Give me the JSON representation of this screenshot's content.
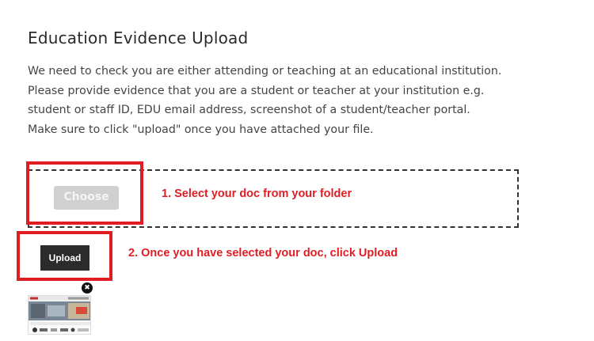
{
  "page": {
    "title": "Education Evidence Upload",
    "description": "We need to check you are either attending or teaching at an educational institution. Please provide evidence that you are a student or teacher at your institution e.g. student or staff ID, EDU email address, screenshot of a student/teacher portal. Make sure to click \"upload\" once you have attached your file."
  },
  "upload": {
    "choose_label": "Choose file",
    "upload_label": "Upload",
    "remove_icon": "close-icon"
  },
  "annotations": {
    "step1": "1. Select your doc from your folder",
    "step2": "2. Once you have selected your doc, click Upload",
    "highlight_color": "#e11d24"
  },
  "thumbnail": {
    "icon": "document-preview"
  }
}
